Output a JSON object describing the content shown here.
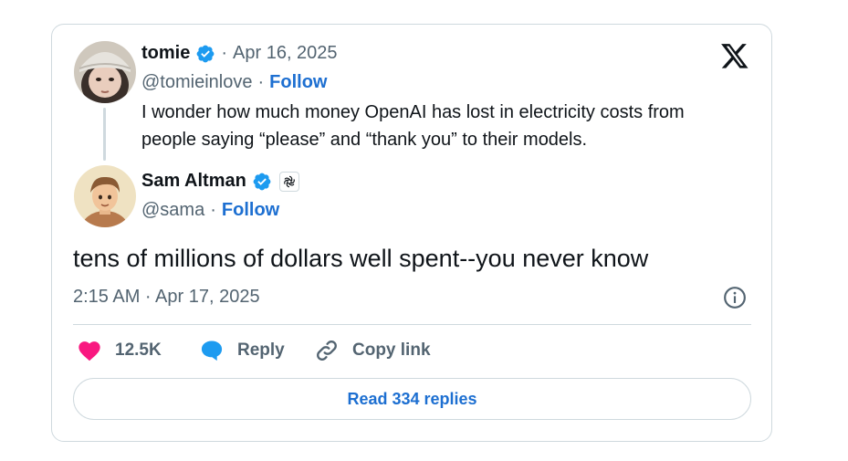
{
  "quoted": {
    "name": "tomie",
    "date": "Apr 16, 2025",
    "handle": "@tomieinlove",
    "follow_label": "Follow",
    "text": "I wonder how much money OpenAI has lost in electricity costs from people saying “please” and “thank you” to their models."
  },
  "reply": {
    "name": "Sam Altman",
    "handle": "@sama",
    "follow_label": "Follow",
    "text": "tens of millions of dollars well spent--you never know",
    "timestamp": "2:15 AM · Apr 17, 2025"
  },
  "actions": {
    "likes": "12.5K",
    "reply_label": "Reply",
    "copy_link_label": "Copy link",
    "read_replies_label": "Read 334 replies"
  },
  "separator": "·",
  "colors": {
    "follow_blue": "#1d6fd1",
    "verified_blue": "#1d9bf0",
    "like_pink": "#f91880",
    "muted_gray": "#536471",
    "border": "#cfd9de"
  },
  "icons": [
    "verified-badge-icon",
    "x-logo-icon",
    "openai-logo-icon",
    "info-icon",
    "heart-icon",
    "reply-bubble-icon",
    "link-icon"
  ]
}
